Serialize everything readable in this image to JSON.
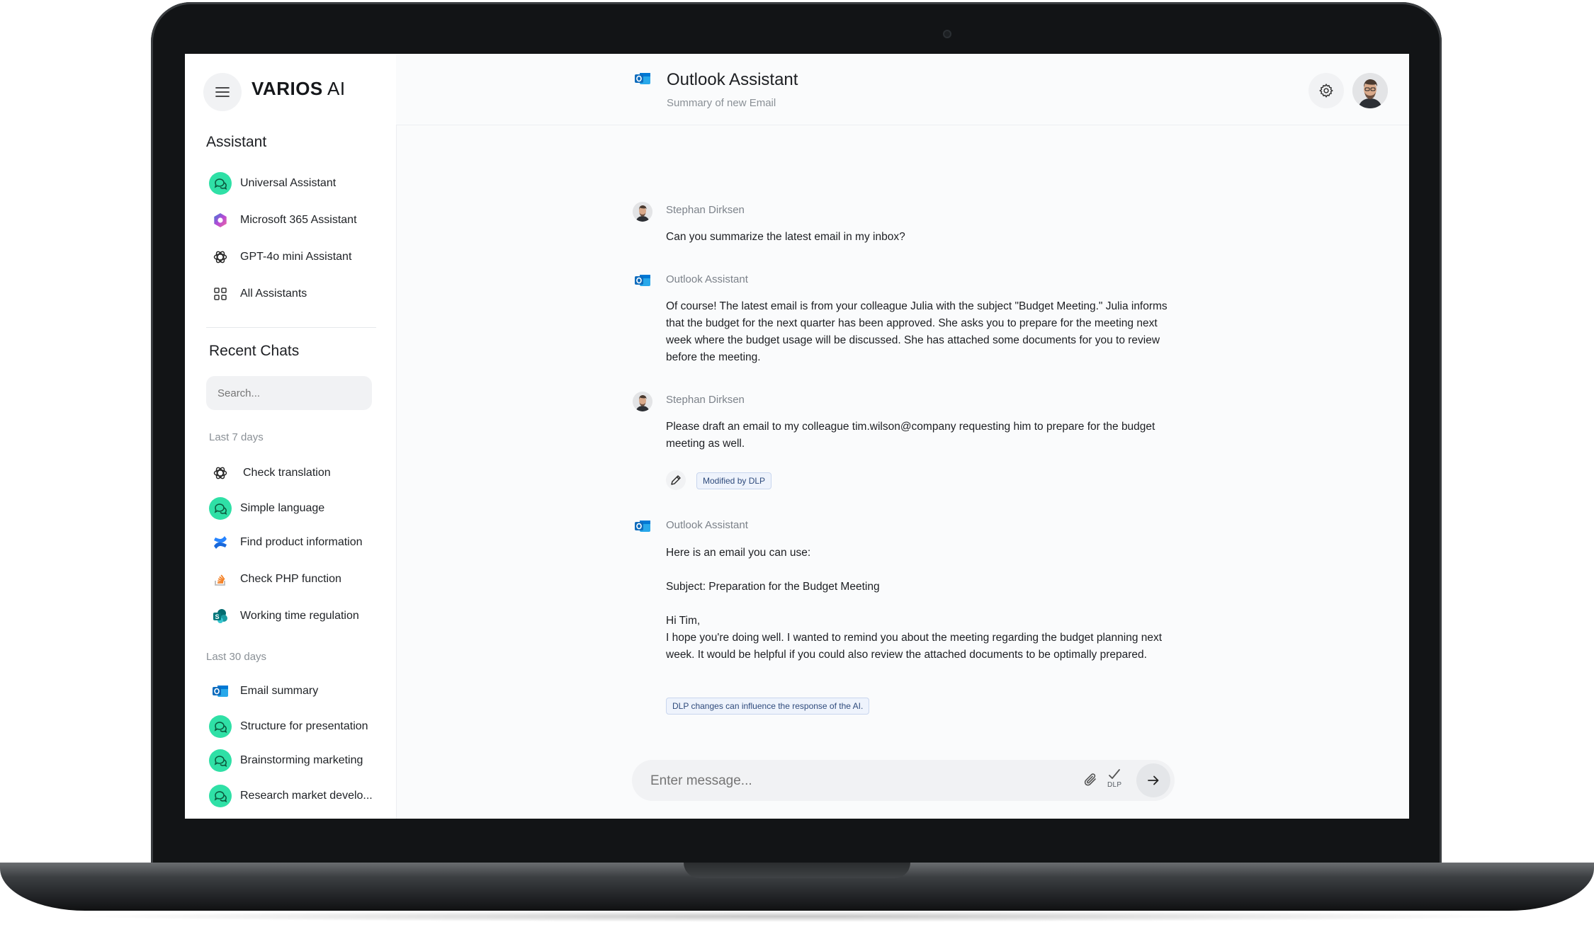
{
  "brand": {
    "name_bold": "VARIOS",
    "name_light": " AI"
  },
  "sidebar": {
    "assistant_title": "Assistant",
    "assistants": [
      {
        "label": "Universal Assistant",
        "icon": "chat-bubbles-icon"
      },
      {
        "label": "Microsoft 365 Assistant",
        "icon": "m365-copilot-icon"
      },
      {
        "label": "GPT-4o mini Assistant",
        "icon": "openai-icon"
      },
      {
        "label": "All Assistants",
        "icon": "grid-icon"
      }
    ],
    "recent_title": "Recent Chats",
    "search_placeholder": "Search...",
    "group_7_days": "Last 7 days",
    "chats_7_days": [
      {
        "label": "Check translation",
        "icon": "openai-icon"
      },
      {
        "label": "Simple language",
        "icon": "chat-bubbles-icon"
      },
      {
        "label": "Find product information",
        "icon": "confluence-icon"
      },
      {
        "label": "Check PHP function",
        "icon": "stackoverflow-icon"
      },
      {
        "label": "Working time regulation",
        "icon": "sharepoint-icon"
      }
    ],
    "group_30_days": "Last 30 days",
    "chats_30_days": [
      {
        "label": "Email summary",
        "icon": "outlook-icon"
      },
      {
        "label": "Structure for presentation",
        "icon": "chat-bubbles-icon"
      },
      {
        "label": "Brainstorming marketing",
        "icon": "chat-bubbles-icon"
      },
      {
        "label": "Research market develo...",
        "icon": "chat-bubbles-icon"
      }
    ]
  },
  "header": {
    "title": "Outlook Assistant",
    "subtitle": "Summary of new Email"
  },
  "messages": [
    {
      "author": "Stephan Dirksen",
      "text": "Can you summarize the latest email in my inbox?"
    },
    {
      "author": "Outlook Assistant",
      "text": "Of course! The latest email is from your colleague Julia with the subject \"Budget Meeting.\" Julia informs that the budget for the next quarter has been approved. She asks you to prepare for the meeting next week where the budget usage will be discussed. She has attached some documents for you to review before the meeting."
    },
    {
      "author": "Stephan Dirksen",
      "text": "Please draft an email to my colleague tim.wilson@company requesting him to prepare for the budget meeting as well.",
      "tag": "Modified by DLP"
    },
    {
      "author": "Outlook Assistant",
      "line1": "Here is an email you can use:",
      "line2": "Subject: Preparation for the Budget Meeting",
      "line3": "Hi Tim,",
      "line4": "I hope you're doing well. I wanted to remind you about the meeting regarding the budget planning next week. It would be helpful if you could also review the attached documents to be optimally prepared.",
      "tag": "DLP changes can influence the response of the AI."
    }
  ],
  "composer": {
    "placeholder": "Enter message...",
    "dlp_label": "DLP"
  },
  "colors": {
    "accent_green": "#2fe0a6",
    "outlook_blue": "#0f6cbd",
    "tag_bg": "#eef3fc"
  }
}
